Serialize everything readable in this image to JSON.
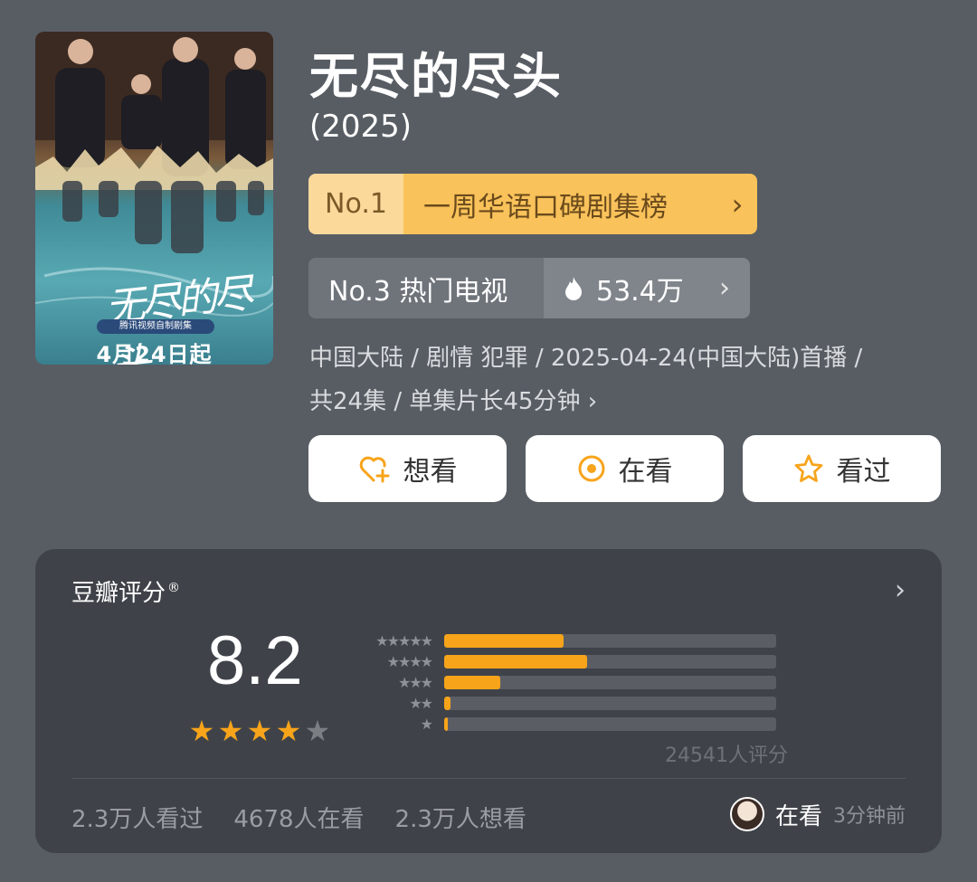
{
  "poster": {
    "title_art": "无尽的尽头",
    "tag": "腾讯视频自制剧集",
    "date": "4月24日起"
  },
  "show": {
    "title": "无尽的尽头",
    "year": "(2025)"
  },
  "ranking_primary": {
    "rank": "No.1",
    "label": "一周华语口碑剧集榜",
    "chevron": "›"
  },
  "ranking_secondary": {
    "rank_label": "No.3 热门电视",
    "heat_icon": "flame-icon",
    "heat_value": "53.4万",
    "chevron": "›"
  },
  "meta": {
    "line1": "中国大陆 / 剧情 犯罪 / 2025-04-24(中国大陆)首播 /",
    "line2": "共24集 / 单集片长45分钟 ›"
  },
  "actions": [
    {
      "label": "想看",
      "icon": "heart-plus-icon"
    },
    {
      "label": "在看",
      "icon": "target-icon"
    },
    {
      "label": "看过",
      "icon": "star-outline-icon"
    }
  ],
  "rating": {
    "title": "豆瓣评分",
    "registered": "®",
    "chevron": "›",
    "score": "8.2",
    "stars_filled": 4,
    "stars_total": 5,
    "distribution": [
      {
        "stars": "★★★★★",
        "fraction": 0.36
      },
      {
        "stars": "★★★★",
        "fraction": 0.43
      },
      {
        "stars": "★★★",
        "fraction": 0.17
      },
      {
        "stars": "★★",
        "fraction": 0.02
      },
      {
        "stars": "★",
        "fraction": 0.01
      }
    ],
    "count_text": "24541人评分",
    "stats": {
      "watched": "2.3万人看过",
      "watching": "4678人在看",
      "want": "2.3万人想看"
    },
    "activity": {
      "status": "在看",
      "time": "3分钟前"
    }
  },
  "colors": {
    "background": "#585d64",
    "card": "#3f4349",
    "accent_orange": "#f7a41b",
    "rank_gold": "#f9c25a"
  }
}
